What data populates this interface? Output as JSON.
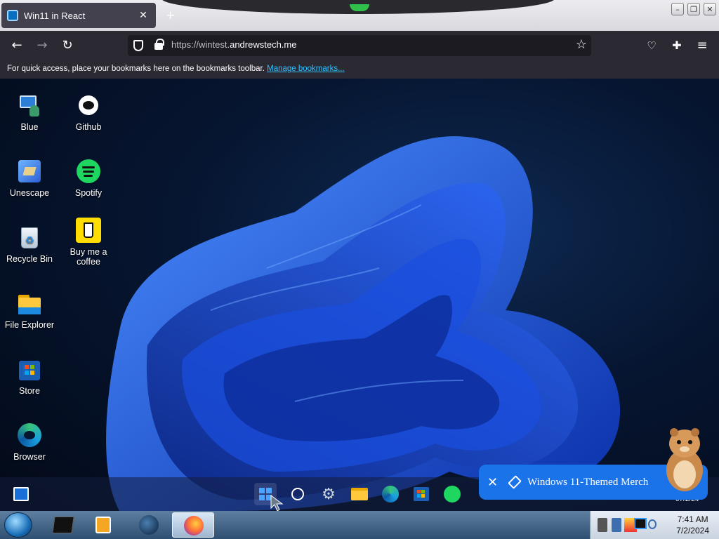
{
  "browser": {
    "tab_title": "Win11 in React",
    "url_prefix": "https://wintest.",
    "url_domain": "andrewstech.me",
    "bookmarks_text": "For quick access, place your bookmarks here on the bookmarks toolbar.",
    "bookmarks_link": "Manage bookmarks..."
  },
  "desktop": {
    "icons": [
      {
        "label": "Blue",
        "icon": "user-computer-icon"
      },
      {
        "label": "Github",
        "icon": "github-icon"
      },
      {
        "label": "Unescape",
        "icon": "unescape-room-icon"
      },
      {
        "label": "Spotify",
        "icon": "spotify-icon"
      },
      {
        "label": "Recycle Bin",
        "icon": "recycle-bin-icon"
      },
      {
        "label": "Buy me a coffee",
        "icon": "coffee-cup-icon"
      },
      {
        "label": "File Explorer",
        "icon": "folder-icon"
      },
      {
        "label": "Store",
        "icon": "store-icon"
      },
      {
        "label": "Browser",
        "icon": "edge-icon"
      }
    ]
  },
  "taskbar": {
    "apps": [
      "widgets-icon",
      "start-icon",
      "search-icon",
      "settings-icon",
      "file-explorer-icon",
      "edge-icon",
      "store-icon",
      "spotify-icon"
    ],
    "tray_date": "07/2/24"
  },
  "toast": {
    "text": "Windows 11-Themed Merch"
  },
  "host_taskbar": {
    "time": "7:41 AM",
    "date": "7/2/2024"
  },
  "colors": {
    "accent_blue": "#1a73e8",
    "spotify_green": "#1ed760",
    "firefox_toolbar": "#2b2a33"
  }
}
